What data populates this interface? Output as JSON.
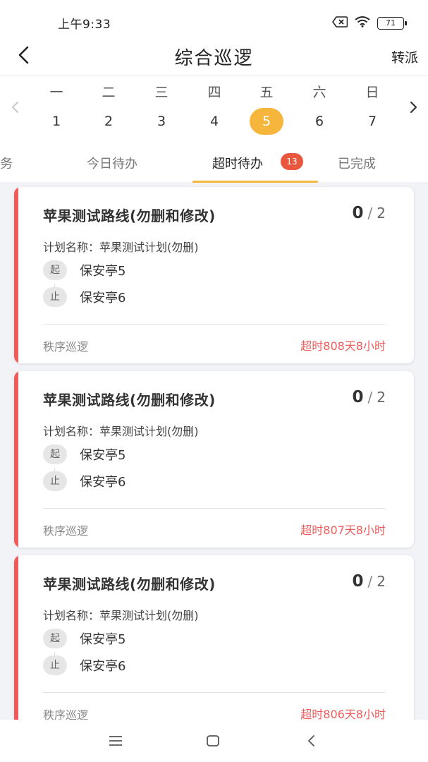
{
  "status_bar": {
    "time": "上午9:33",
    "battery": "71",
    "icons": [
      "sim-error-icon",
      "wifi-icon",
      "battery-icon"
    ]
  },
  "nav": {
    "title": "综合巡逻",
    "action": "转派",
    "back_icon": "chevron-left-icon"
  },
  "week": {
    "days": [
      {
        "name": "一",
        "num": "1",
        "selected": false
      },
      {
        "name": "二",
        "num": "2",
        "selected": false
      },
      {
        "name": "三",
        "num": "3",
        "selected": false
      },
      {
        "name": "四",
        "num": "4",
        "selected": false
      },
      {
        "name": "五",
        "num": "5",
        "selected": true
      },
      {
        "name": "六",
        "num": "6",
        "selected": false
      },
      {
        "name": "日",
        "num": "7",
        "selected": false
      }
    ],
    "selected_color": "#f6b53b"
  },
  "tabs": {
    "items": [
      {
        "label": "任务"
      },
      {
        "label": "今日待办"
      },
      {
        "label": "超时待办",
        "badge": "13",
        "active": true
      },
      {
        "label": "已完成"
      }
    ],
    "active_color": "#f6b53b",
    "badge_color": "#e9573f"
  },
  "cards": [
    {
      "title": "苹果测试路线(勿删和修改)",
      "done": "0",
      "sep": "/",
      "total": "2",
      "plan": "计划名称：苹果测试计划(勿删)",
      "start_label": "起",
      "start": "保安亭5",
      "end_label": "止",
      "end": "保安亭6",
      "type": "秩序巡逻",
      "overdue": "超时808天8小时"
    },
    {
      "title": "苹果测试路线(勿删和修改)",
      "done": "0",
      "sep": "/",
      "total": "2",
      "plan": "计划名称：苹果测试计划(勿删)",
      "start_label": "起",
      "start": "保安亭5",
      "end_label": "止",
      "end": "保安亭6",
      "type": "秩序巡逻",
      "overdue": "超时807天8小时"
    },
    {
      "title": "苹果测试路线(勿删和修改)",
      "done": "0",
      "sep": "/",
      "total": "2",
      "plan": "计划名称：苹果测试计划(勿删)",
      "start_label": "起",
      "start": "保安亭5",
      "end_label": "止",
      "end": "保安亭6",
      "type": "秩序巡逻",
      "overdue": "超时806天8小时"
    }
  ],
  "colors": {
    "accent_red": "#ee5b5b",
    "background": "#f2f3f7"
  },
  "system_nav": [
    "menu-icon",
    "home-icon",
    "back-icon"
  ]
}
